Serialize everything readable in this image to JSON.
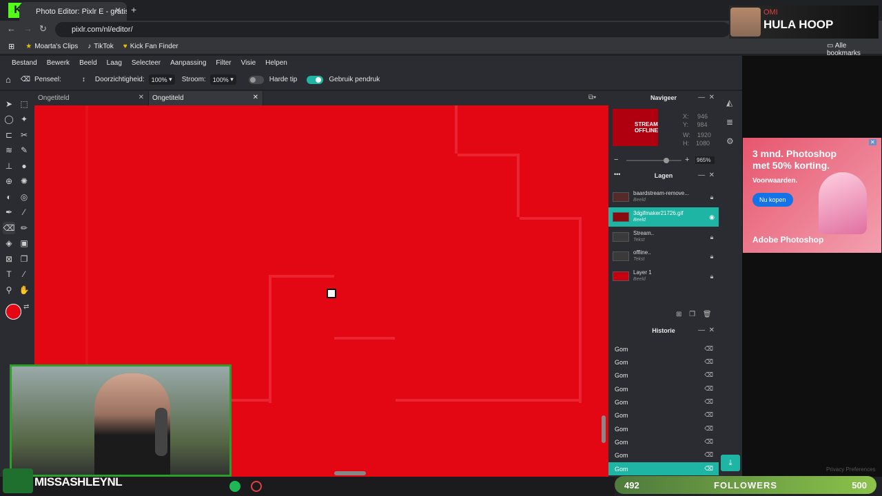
{
  "browser": {
    "tab_title": "Photo Editor: Pixlr E - gratis hulp",
    "url": "pixlr.com/nl/editor/",
    "bookmarks": [
      {
        "label": "Moarta's Clips",
        "icon": "star-icon"
      },
      {
        "label": "TikTok",
        "icon": "tiktok-icon"
      },
      {
        "label": "Kick Fan Finder",
        "icon": "heart-icon"
      }
    ],
    "all_bookmarks": "Alle bookmarks"
  },
  "menu": [
    "Bestand",
    "Bewerk",
    "Beeld",
    "Laag",
    "Selecteer",
    "Aanpassing",
    "Filter",
    "Visie",
    "Helpen"
  ],
  "tool_options": {
    "tool": "Penseel:",
    "opacity_label": "Doorzichtigheid:",
    "opacity_value": "100%",
    "flow_label": "Stroom:",
    "flow_value": "100%",
    "hard_tip": "Harde tip",
    "pressure": "Gebruik pendruk"
  },
  "doc_tabs": [
    "Ongetiteld",
    "Ongetiteld"
  ],
  "navigator": {
    "title": "Navigeer",
    "x": "946",
    "y": "984",
    "w": "1920",
    "h": "1080",
    "x_label": "X:",
    "y_label": "Y:",
    "w_label": "W:",
    "h_label": "H:",
    "zoom": "965%",
    "thumb_text": "STREAM OFFLINE"
  },
  "layers": {
    "title": "Lagen",
    "items": [
      {
        "name": "baardstream-remove...",
        "type": "Beeld",
        "active": false,
        "thumb": "#552a2a"
      },
      {
        "name": "3dgifmaker21726.gif",
        "type": "Beeld",
        "active": true,
        "thumb": "#8a0a10"
      },
      {
        "name": "Stream..",
        "type": "Tekst",
        "active": false,
        "thumb": "#3a3a3a"
      },
      {
        "name": "offline..",
        "type": "Tekst",
        "active": false,
        "thumb": "#3a3a3a"
      },
      {
        "name": "Layer 1",
        "type": "Beeld",
        "active": false,
        "thumb": "#c5000f"
      }
    ]
  },
  "history": {
    "title": "Historie",
    "items": [
      "Gom",
      "Gom",
      "Gom",
      "Gom",
      "Gom",
      "Gom",
      "Gom",
      "Gom",
      "Gom",
      "Gom"
    ]
  },
  "ad": {
    "headline": "3 mnd. Photoshop met 50% korting.",
    "sub": "Voorwaarden.",
    "cta": "Nu kopen",
    "brand": "Adobe Photoshop"
  },
  "privacy": "Privacy Preferences",
  "alert": {
    "user": "OMI",
    "text": "HULA HOOP"
  },
  "streamer": "MISSASHLEYNL",
  "followers": {
    "current": "492",
    "label": "FOLLOWERS",
    "goal": "500"
  },
  "colors": {
    "accent": "#1fb5a5",
    "primary": "#e30613",
    "secondary": "#111111"
  }
}
